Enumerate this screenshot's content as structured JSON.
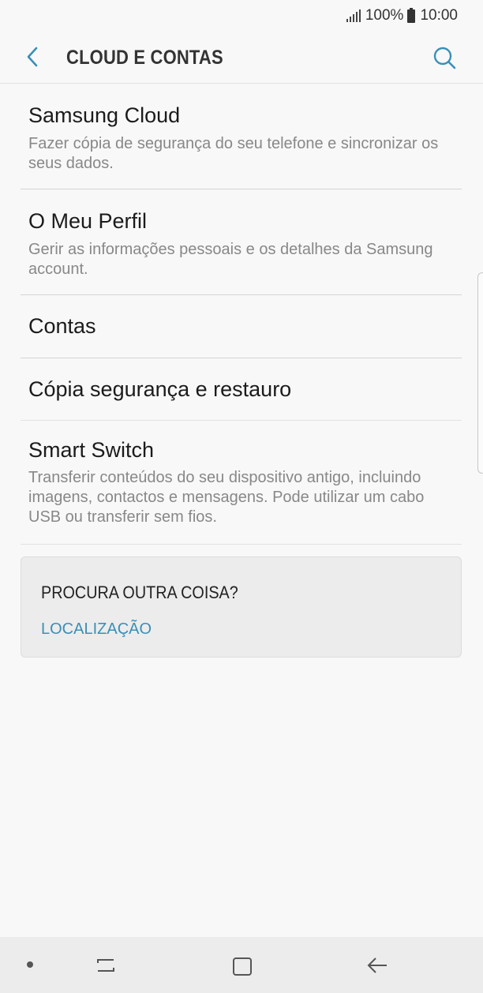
{
  "status_bar": {
    "battery": "100%",
    "time": "10:00",
    "icons": [
      "signal-icon",
      "battery-icon"
    ]
  },
  "header": {
    "title": "CLOUD E CONTAS",
    "back_icon": "back-arrow-icon",
    "search_icon": "search-icon",
    "accent_color": "#3a8fb7"
  },
  "items": [
    {
      "title": "Samsung Cloud",
      "subtitle": "Fazer cópia de segurança do seu telefone e sincronizar os seus dados."
    },
    {
      "title": "O Meu Perfil",
      "subtitle": "Gerir as informações pessoais e os detalhes da Samsung account."
    },
    {
      "title": "Contas",
      "subtitle": ""
    },
    {
      "title": "Cópia segurança e restauro",
      "subtitle": ""
    },
    {
      "title": "Smart Switch",
      "subtitle": "Transferir conteúdos do seu dispositivo antigo, incluindo imagens, contactos e mensagens. Pode utilizar um cabo USB ou transferir sem fios."
    }
  ],
  "suggestion_card": {
    "title": "PROCURA OUTRA COISA?",
    "link": "LOCALIZAÇÃO"
  },
  "nav_bar": {
    "icons": [
      "recents-icon",
      "home-icon",
      "back-icon"
    ]
  }
}
